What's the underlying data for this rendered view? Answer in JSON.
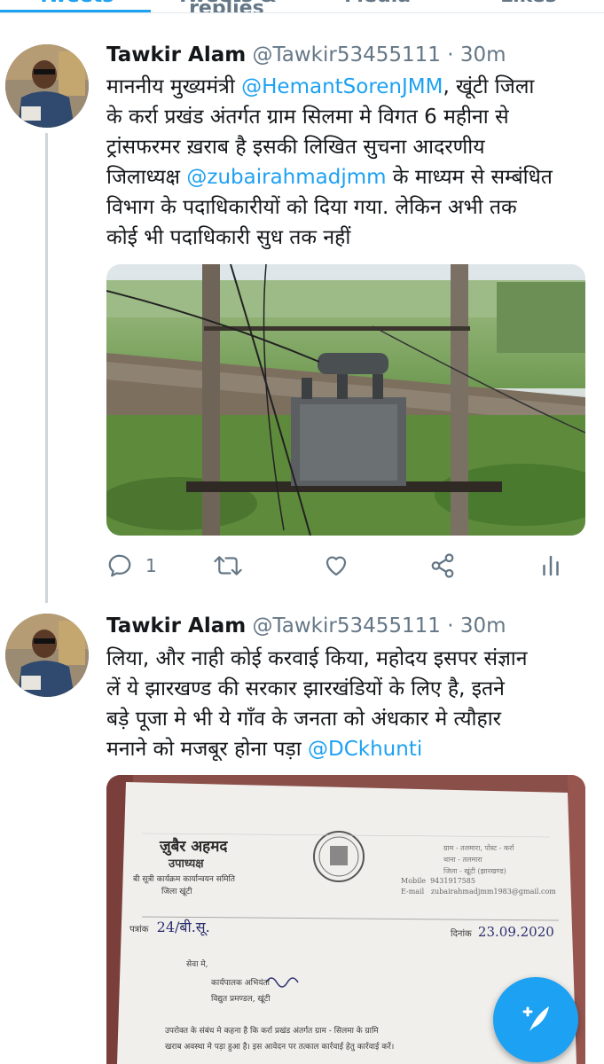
{
  "tabs": [
    {
      "label": "Tweets",
      "active": true
    },
    {
      "label": "Tweets & replies",
      "active": false
    },
    {
      "label": "Media",
      "active": false
    },
    {
      "label": "Likes",
      "active": false
    }
  ],
  "tweets": [
    {
      "name": "Tawkir Alam",
      "handle": "@Tawkir53455111",
      "time": "30m",
      "text_lines": [
        [
          "माननीय मुख्यमंत्री ",
          "@HemantSorenJMM",
          ", खूंटी जिला"
        ],
        [
          "के  कर्रा  प्रखंड अंतर्गत  ग्राम सिलमा मे विगत 6 महीना से"
        ],
        [
          "ट्रांसफरमर ख़राब है इसकी लिखित सुचना आदरणीय"
        ],
        [
          "जिलाध्यक्ष ",
          "@zubairahmadjmm",
          " के माध्यम से सम्बंधित"
        ],
        [
          "विभाग के पदाधिकारीयों को दिया गया. लेकिन अभी तक"
        ],
        [
          "कोई भी पदाधिकारी सुध तक नहीं"
        ]
      ],
      "reply_count": "1"
    },
    {
      "name": "Tawkir Alam",
      "handle": "@Tawkir53455111",
      "time": "30m",
      "text_lines": [
        [
          "लिया, और नाही कोई करवाई किया,  महोदय इसपर संज्ञान"
        ],
        [
          "लें ये झारखण्ड की सरकार झारखंडियों के लिए है, इतने"
        ],
        [
          "बड़े पूजा मे भी  ये गाँव के जनता को अंधकार मे त्यौहार"
        ],
        [
          "मनाने को मजबूर होना पड़ा ",
          "@DCkhunti"
        ]
      ]
    }
  ],
  "letter": {
    "sender_name": "ज़ुबैर अहमद",
    "sender_title": "उपाध्यक्ष",
    "sender_org": "बी सूत्री कार्यक्रम कार्यान्वयन समिति",
    "sender_district": "जिला खूंटी",
    "address_lines": [
      "ग्राम - तलमारा, पोस्ट - कर्रा",
      "थाना - तलमारा",
      "जिला - खूंटी (झारखण्ड)"
    ],
    "mobile_label": "Mobile",
    "mobile": "9431917585",
    "email_label": "E-mail",
    "email": "zubairahmadjmm1983@gmail.com",
    "ref_label": "पत्रांक",
    "ref_value": "24/बी.सू.",
    "date_label": "दिनांक",
    "date_value": "23.09.2020",
    "to_label": "सेवा मे,",
    "recipient_lines": [
      "कार्यपालक अभियंता",
      "विद्युत प्रमण्डल, खूंटी"
    ],
    "body_line1": "उपरोक्त के संबंध मे कहना है कि कर्रा प्रखंड अंतर्गत ग्राम - सिलमा के ग्रामि",
    "body_line2": "खराब अवस्था मे पड़ा हुआ है। इस आवेदन पर तत्काल कार्रवाई हेतु कार्रवाई करें।"
  },
  "colors": {
    "accent": "#1da1f2",
    "text": "#14171a",
    "muted": "#657786",
    "divider": "#e1e8ed",
    "thread_line": "#ccd6dd"
  },
  "icons": [
    "reply-icon",
    "retweet-icon",
    "like-icon",
    "share-icon",
    "analytics-icon",
    "compose-tweet-icon"
  ]
}
